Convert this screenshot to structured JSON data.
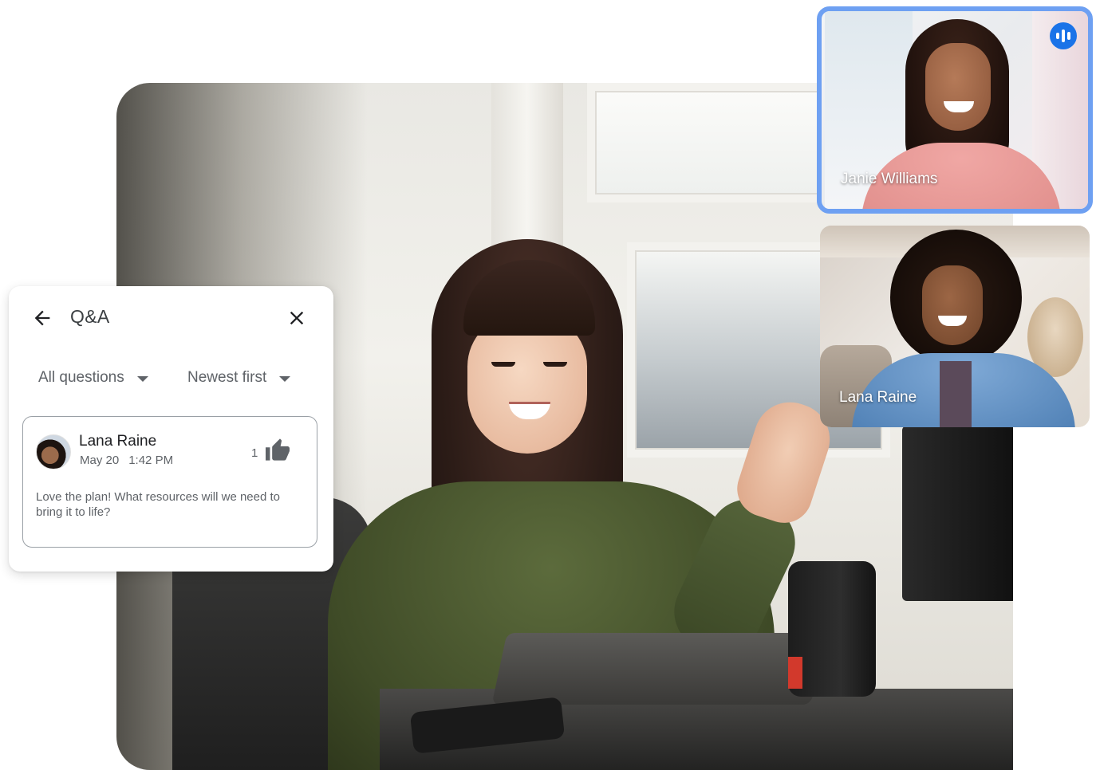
{
  "tiles": {
    "janie": {
      "name": "Janie Williams"
    },
    "lana": {
      "name": "Lana Raine"
    }
  },
  "qa": {
    "title": "Q&A",
    "filter_scope": "All questions",
    "filter_sort": "Newest first",
    "question": {
      "author": "Lana Raine",
      "date": "May 20",
      "time": "1:42 PM",
      "likes": "1",
      "text": "Love the plan! What resources will we need to bring it to life?"
    }
  },
  "icons": {
    "back": "arrow-back-icon",
    "close": "close-icon",
    "dropdown": "caret-down-icon",
    "like": "thumb-up-icon",
    "speaking": "speaking-indicator-icon"
  },
  "colors": {
    "accent": "#1a73e8",
    "active_tile_border": "#6ea0f2",
    "text_primary": "#202124",
    "text_secondary": "#5f6368"
  }
}
